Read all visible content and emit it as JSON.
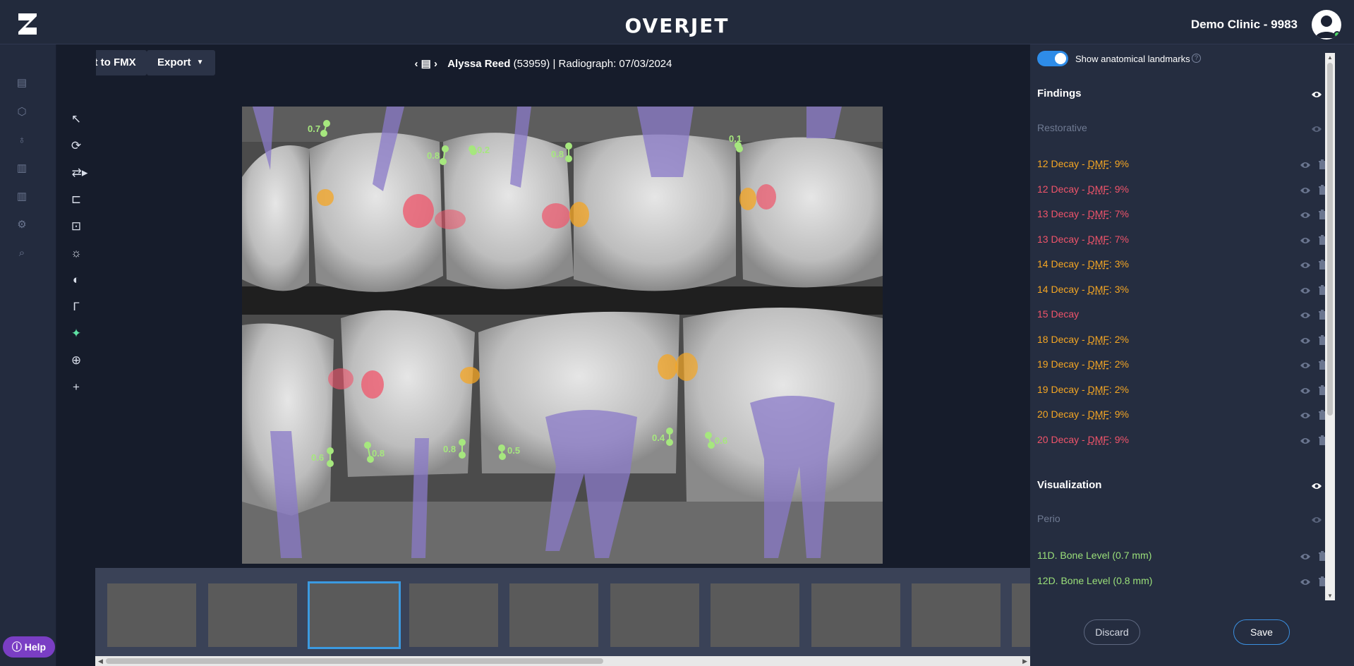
{
  "header": {
    "brand": "OVERJET",
    "clinic": "Demo Clinic - 9983"
  },
  "toolbar": {
    "exit_label": "Exit to FMX",
    "export_label": "Export"
  },
  "patient": {
    "name": "Alyssa Reed",
    "id": "(53959)",
    "radiograph": "| Radiograph: 07/03/2024"
  },
  "xray": {
    "measurements": [
      "0.7",
      "0.8",
      "0.2",
      "0.8",
      "0.1",
      "0.6",
      "0.8",
      "0.8",
      "0.5",
      "0.4",
      "0.6"
    ]
  },
  "help_label": "Help",
  "panel": {
    "landmarks_label": "Show anatomical landmarks",
    "findings_title": "Findings",
    "restorative_label": "Restorative",
    "findings": [
      {
        "tooth": "12 Decay - ",
        "dmf": "DMF",
        "pct": ": 9%",
        "color": "#f5a623"
      },
      {
        "tooth": "12 Decay - ",
        "dmf": "DMF",
        "pct": ": 9%",
        "color": "#f0546a"
      },
      {
        "tooth": "13 Decay - ",
        "dmf": "DMF",
        "pct": ": 7%",
        "color": "#f0546a"
      },
      {
        "tooth": "13 Decay - ",
        "dmf": "DMF",
        "pct": ": 7%",
        "color": "#f0546a"
      },
      {
        "tooth": "14 Decay - ",
        "dmf": "DMF",
        "pct": ": 3%",
        "color": "#f5a623"
      },
      {
        "tooth": "14 Decay - ",
        "dmf": "DMF",
        "pct": ": 3%",
        "color": "#f5a623"
      },
      {
        "tooth": "15 Decay",
        "dmf": "",
        "pct": "",
        "color": "#f0546a"
      },
      {
        "tooth": "18 Decay - ",
        "dmf": "DMF",
        "pct": ": 2%",
        "color": "#f5a623"
      },
      {
        "tooth": "19 Decay - ",
        "dmf": "DMF",
        "pct": ": 2%",
        "color": "#f5a623"
      },
      {
        "tooth": "19 Decay - ",
        "dmf": "DMF",
        "pct": ": 2%",
        "color": "#f5a623"
      },
      {
        "tooth": "20 Decay - ",
        "dmf": "DMF",
        "pct": ": 9%",
        "color": "#f5a623"
      },
      {
        "tooth": "20 Decay - ",
        "dmf": "DMF",
        "pct": ": 9%",
        "color": "#f0546a"
      }
    ],
    "visualization_title": "Visualization",
    "perio_label": "Perio",
    "bone_levels": [
      "11D. Bone Level (0.7 mm)",
      "12D. Bone Level (0.8 mm)"
    ],
    "discard_label": "Discard",
    "save_label": "Save"
  },
  "colors": {
    "decay_orange": "#f5a623",
    "decay_red": "#f0546a",
    "bone_green": "#9be07a",
    "accent_blue": "#2e8ce8"
  }
}
